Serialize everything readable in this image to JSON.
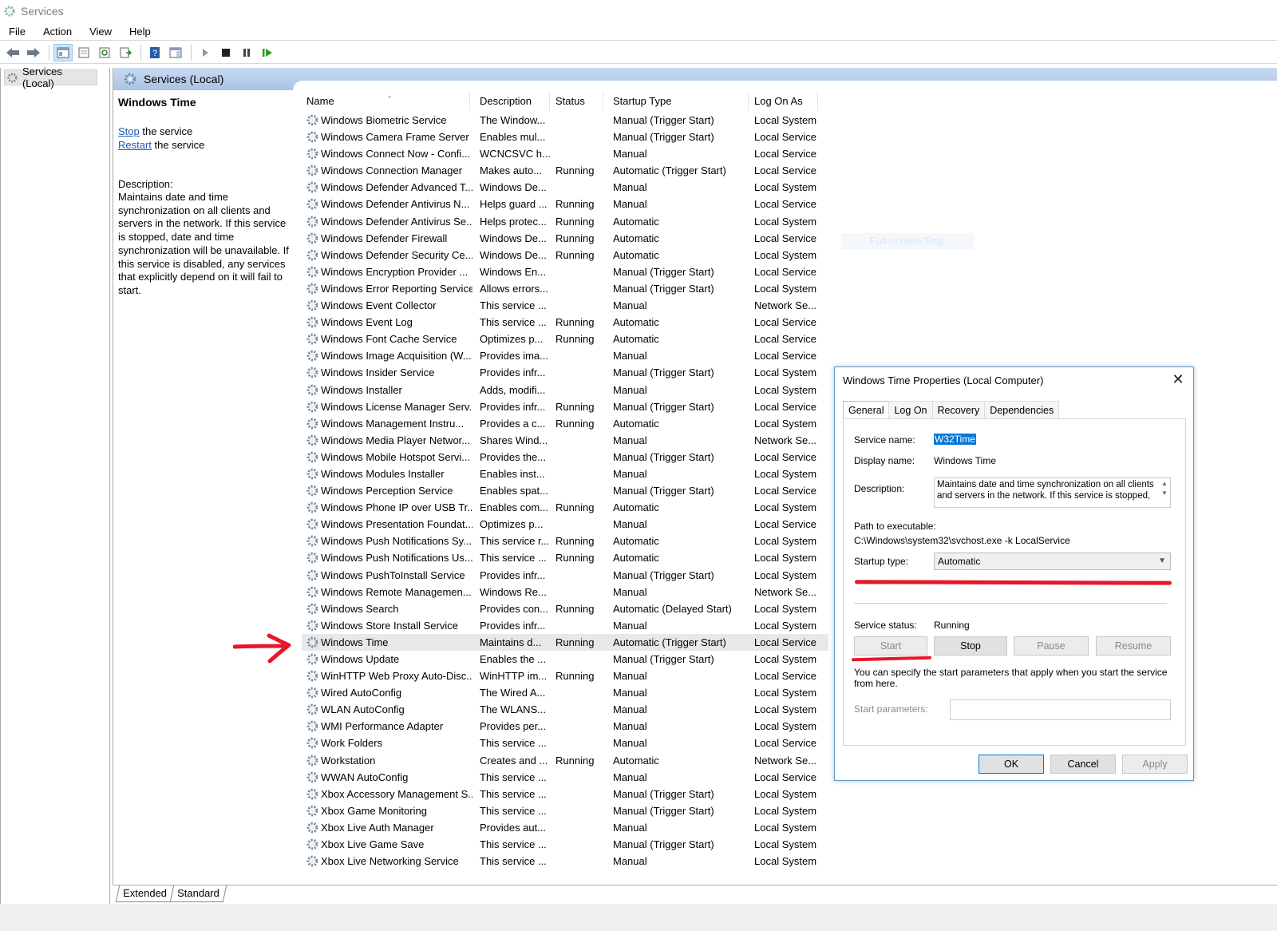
{
  "window": {
    "title": "Services"
  },
  "menu": [
    "File",
    "Action",
    "View",
    "Help"
  ],
  "tree": {
    "root": "Services (Local)"
  },
  "main": {
    "header": "Services (Local)"
  },
  "detail": {
    "title": "Windows Time",
    "stop_link": "Stop",
    "stop_suffix": " the service",
    "restart_link": "Restart",
    "restart_suffix": " the service",
    "desc_label": "Description:",
    "desc_text": "Maintains date and time synchronization on all clients and servers in the network. If this service is stopped, date and time synchronization will be unavailable. If this service is disabled, any services that explicitly depend on it will fail to start."
  },
  "columns": {
    "name": "Name",
    "description": "Description",
    "status": "Status",
    "startup": "Startup Type",
    "logon": "Log On As"
  },
  "services": [
    [
      "Windows Biometric Service",
      "The Window...",
      "",
      "Manual (Trigger Start)",
      "Local System"
    ],
    [
      "Windows Camera Frame Server",
      "Enables mul...",
      "",
      "Manual (Trigger Start)",
      "Local Service"
    ],
    [
      "Windows Connect Now - Confi...",
      "WCNCSVC h...",
      "",
      "Manual",
      "Local Service"
    ],
    [
      "Windows Connection Manager",
      "Makes auto...",
      "Running",
      "Automatic (Trigger Start)",
      "Local Service"
    ],
    [
      "Windows Defender Advanced T...",
      "Windows De...",
      "",
      "Manual",
      "Local System"
    ],
    [
      "Windows Defender Antivirus N...",
      "Helps guard ...",
      "Running",
      "Manual",
      "Local Service"
    ],
    [
      "Windows Defender Antivirus Se...",
      "Helps protec...",
      "Running",
      "Automatic",
      "Local System"
    ],
    [
      "Windows Defender Firewall",
      "Windows De...",
      "Running",
      "Automatic",
      "Local Service"
    ],
    [
      "Windows Defender Security Ce...",
      "Windows De...",
      "Running",
      "Automatic",
      "Local System"
    ],
    [
      "Windows Encryption Provider ...",
      "Windows En...",
      "",
      "Manual (Trigger Start)",
      "Local Service"
    ],
    [
      "Windows Error Reporting Service",
      "Allows errors...",
      "",
      "Manual (Trigger Start)",
      "Local System"
    ],
    [
      "Windows Event Collector",
      "This service ...",
      "",
      "Manual",
      "Network Se..."
    ],
    [
      "Windows Event Log",
      "This service ...",
      "Running",
      "Automatic",
      "Local Service"
    ],
    [
      "Windows Font Cache Service",
      "Optimizes p...",
      "Running",
      "Automatic",
      "Local Service"
    ],
    [
      "Windows Image Acquisition (W...",
      "Provides ima...",
      "",
      "Manual",
      "Local Service"
    ],
    [
      "Windows Insider Service",
      "Provides infr...",
      "",
      "Manual (Trigger Start)",
      "Local System"
    ],
    [
      "Windows Installer",
      "Adds, modifi...",
      "",
      "Manual",
      "Local System"
    ],
    [
      "Windows License Manager Serv...",
      "Provides infr...",
      "Running",
      "Manual (Trigger Start)",
      "Local Service"
    ],
    [
      "Windows Management Instru...",
      "Provides a c...",
      "Running",
      "Automatic",
      "Local System"
    ],
    [
      "Windows Media Player Networ...",
      "Shares Wind...",
      "",
      "Manual",
      "Network Se..."
    ],
    [
      "Windows Mobile Hotspot Servi...",
      "Provides the...",
      "",
      "Manual (Trigger Start)",
      "Local Service"
    ],
    [
      "Windows Modules Installer",
      "Enables inst...",
      "",
      "Manual",
      "Local System"
    ],
    [
      "Windows Perception Service",
      "Enables spat...",
      "",
      "Manual (Trigger Start)",
      "Local Service"
    ],
    [
      "Windows Phone IP over USB Tr...",
      "Enables com...",
      "Running",
      "Automatic",
      "Local System"
    ],
    [
      "Windows Presentation Foundat...",
      "Optimizes p...",
      "",
      "Manual",
      "Local Service"
    ],
    [
      "Windows Push Notifications Sy...",
      "This service r...",
      "Running",
      "Automatic",
      "Local System"
    ],
    [
      "Windows Push Notifications Us...",
      "This service ...",
      "Running",
      "Automatic",
      "Local System"
    ],
    [
      "Windows PushToInstall Service",
      "Provides infr...",
      "",
      "Manual (Trigger Start)",
      "Local System"
    ],
    [
      "Windows Remote Managemen...",
      "Windows Re...",
      "",
      "Manual",
      "Network Se..."
    ],
    [
      "Windows Search",
      "Provides con...",
      "Running",
      "Automatic (Delayed Start)",
      "Local System"
    ],
    [
      "Windows Store Install Service",
      "Provides infr...",
      "",
      "Manual",
      "Local System"
    ],
    [
      "Windows Time",
      "Maintains d...",
      "Running",
      "Automatic (Trigger Start)",
      "Local Service"
    ],
    [
      "Windows Update",
      "Enables the ...",
      "",
      "Manual (Trigger Start)",
      "Local System"
    ],
    [
      "WinHTTP Web Proxy Auto-Disc...",
      "WinHTTP im...",
      "Running",
      "Manual",
      "Local Service"
    ],
    [
      "Wired AutoConfig",
      "The Wired A...",
      "",
      "Manual",
      "Local System"
    ],
    [
      "WLAN AutoConfig",
      "The WLANS...",
      "",
      "Manual",
      "Local System"
    ],
    [
      "WMI Performance Adapter",
      "Provides per...",
      "",
      "Manual",
      "Local System"
    ],
    [
      "Work Folders",
      "This service ...",
      "",
      "Manual",
      "Local Service"
    ],
    [
      "Workstation",
      "Creates and ...",
      "Running",
      "Automatic",
      "Network Se..."
    ],
    [
      "WWAN AutoConfig",
      "This service ...",
      "",
      "Manual",
      "Local Service"
    ],
    [
      "Xbox Accessory Management S...",
      "This service ...",
      "",
      "Manual (Trigger Start)",
      "Local System"
    ],
    [
      "Xbox Game Monitoring",
      "This service ...",
      "",
      "Manual (Trigger Start)",
      "Local System"
    ],
    [
      "Xbox Live Auth Manager",
      "Provides aut...",
      "",
      "Manual",
      "Local System"
    ],
    [
      "Xbox Live Game Save",
      "This service ...",
      "",
      "Manual (Trigger Start)",
      "Local System"
    ],
    [
      "Xbox Live Networking Service",
      "This service ...",
      "",
      "Manual",
      "Local System"
    ]
  ],
  "selected_service": "Windows Time",
  "bottom_tabs": [
    "Extended",
    "Standard"
  ],
  "watermark": "Full-screen Snip",
  "dialog": {
    "title": "Windows Time Properties (Local Computer)",
    "tabs": [
      "General",
      "Log On",
      "Recovery",
      "Dependencies"
    ],
    "service_name_label": "Service name:",
    "service_name": "W32Time",
    "display_name_label": "Display name:",
    "display_name": "Windows Time",
    "description_label": "Description:",
    "description": "Maintains date and time synchronization on all clients and servers in the network. If this service is stopped,",
    "path_label": "Path to executable:",
    "path": "C:\\Windows\\system32\\svchost.exe -k LocalService",
    "startup_label": "Startup type:",
    "startup_value": "Automatic",
    "status_label": "Service status:",
    "status_value": "Running",
    "btn_start": "Start",
    "btn_stop": "Stop",
    "btn_pause": "Pause",
    "btn_resume": "Resume",
    "hint": "You can specify the start parameters that apply when you start the service from here.",
    "params_label": "Start parameters:",
    "btn_ok": "OK",
    "btn_cancel": "Cancel",
    "btn_apply": "Apply"
  },
  "colors": {
    "annotation_red": "#e8162b",
    "header_blue": "#b9cfe9",
    "selection_blue": "#0078d7",
    "link_blue": "#1a5bb5"
  },
  "icons": [
    "gear-icon",
    "back-arrow-icon",
    "forward-arrow-icon",
    "play-icon",
    "stop-icon",
    "pause-icon",
    "restart-icon",
    "help-icon",
    "close-icon",
    "chevron-down-icon"
  ]
}
